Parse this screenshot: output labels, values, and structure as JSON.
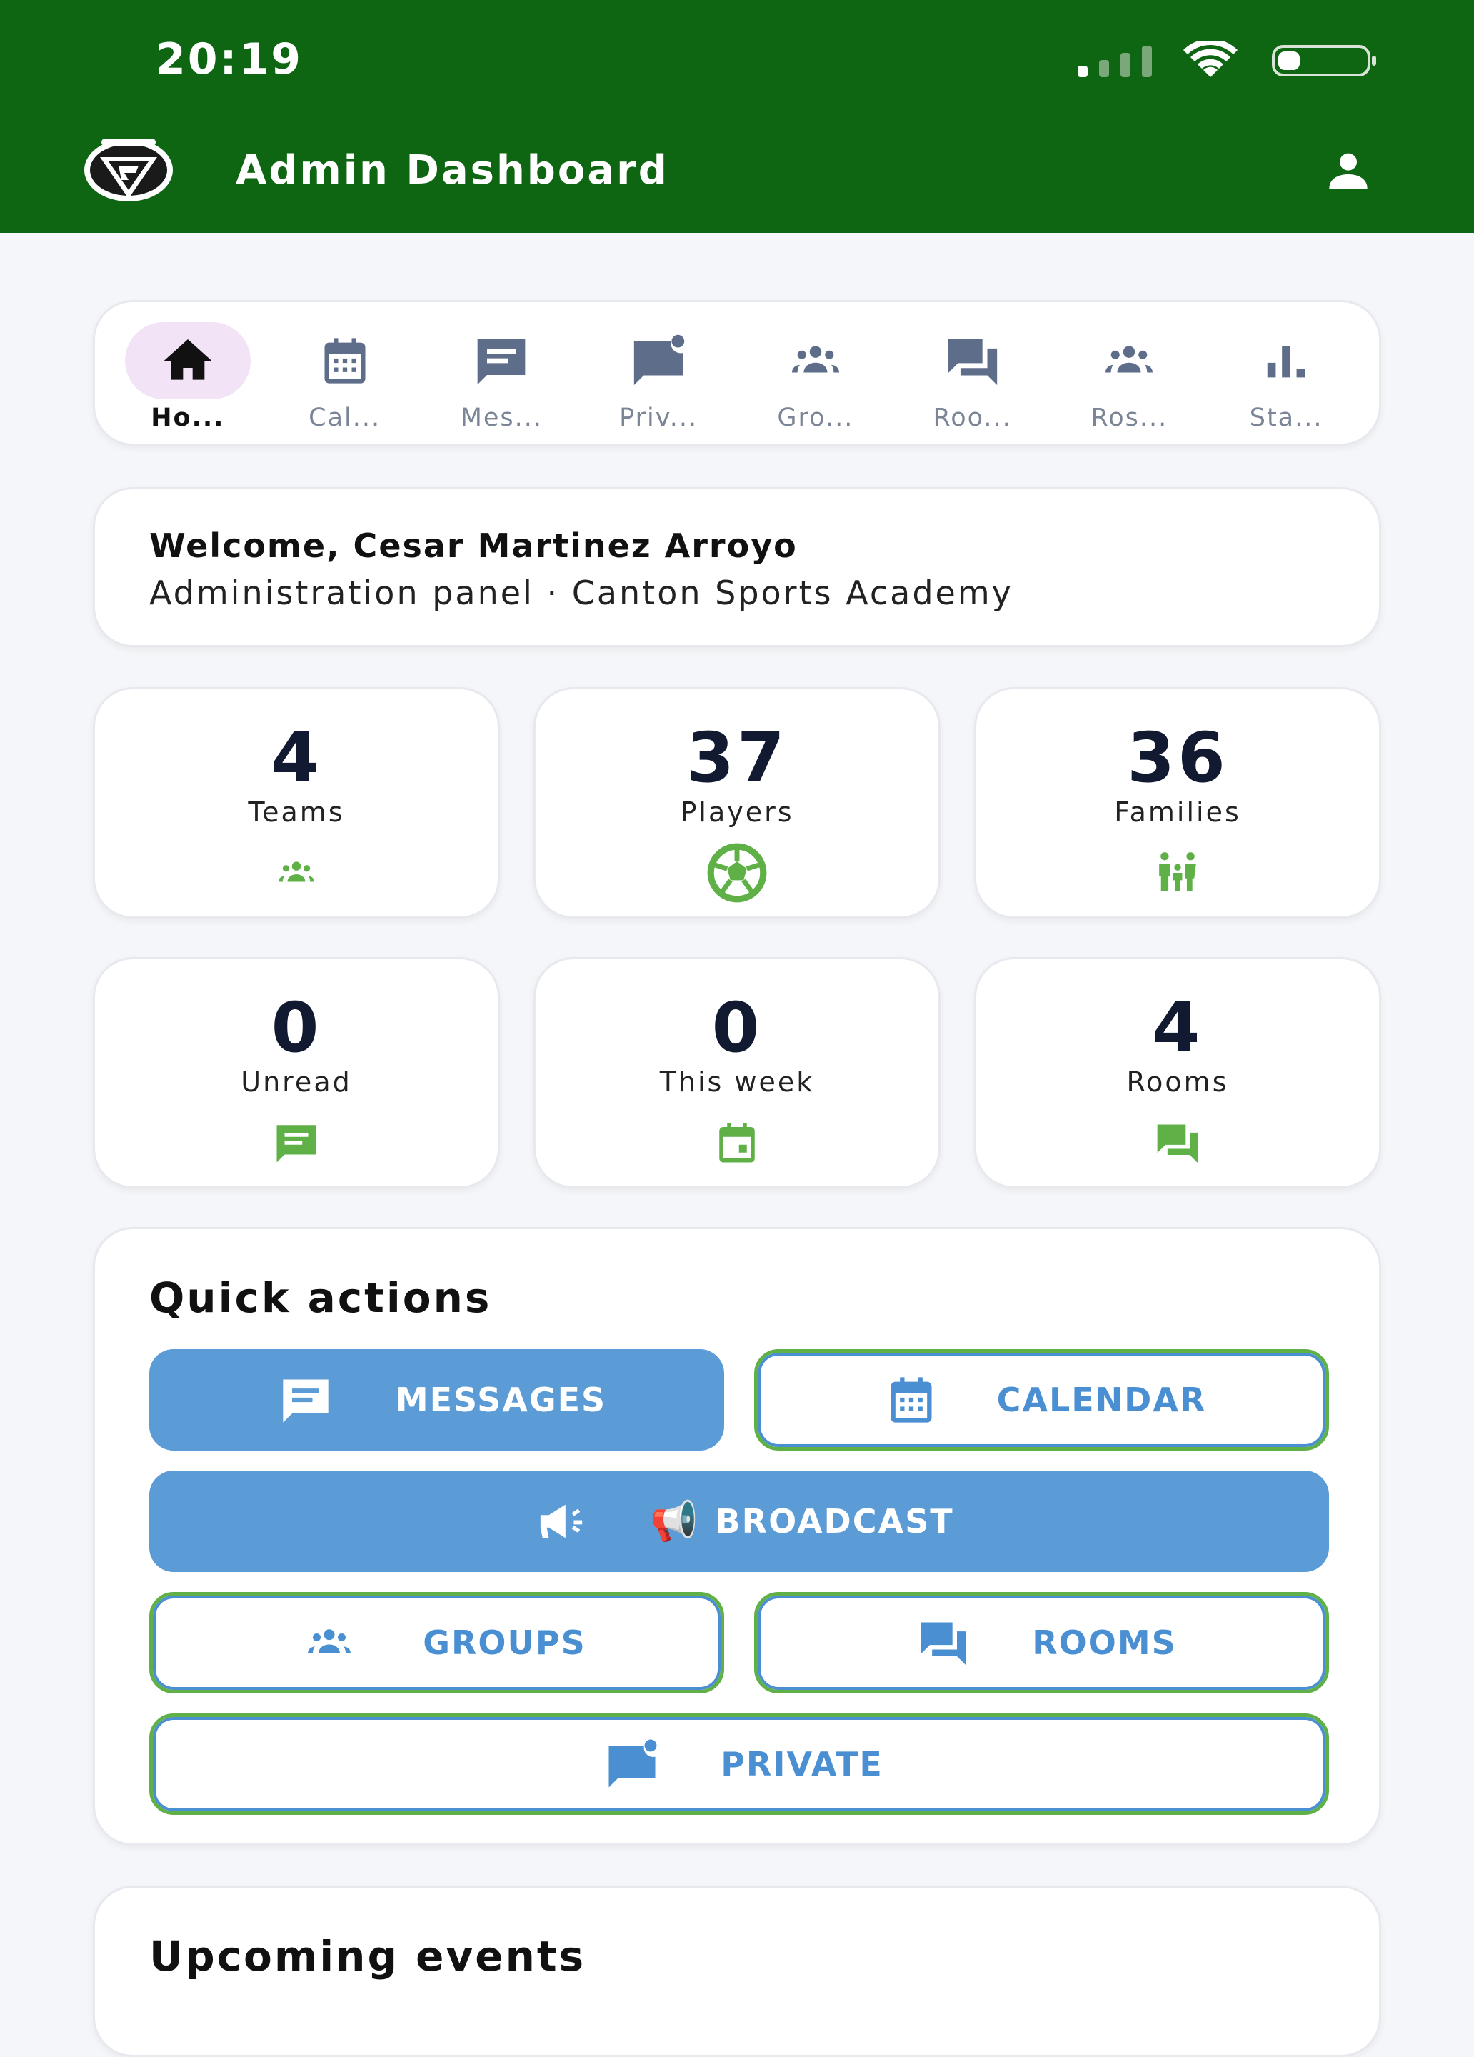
{
  "status_bar": {
    "time": "20:19"
  },
  "header": {
    "title": "Admin Dashboard"
  },
  "tabs": [
    {
      "label": "Ho...",
      "icon": "home-icon",
      "active": true
    },
    {
      "label": "Cal...",
      "icon": "calendar-icon"
    },
    {
      "label": "Mes...",
      "icon": "message-icon"
    },
    {
      "label": "Priv...",
      "icon": "private-message-icon"
    },
    {
      "label": "Gro...",
      "icon": "groups-icon"
    },
    {
      "label": "Roo...",
      "icon": "rooms-icon"
    },
    {
      "label": "Ros...",
      "icon": "roster-icon"
    },
    {
      "label": "Sta...",
      "icon": "stats-icon"
    }
  ],
  "welcome": {
    "title": "Welcome, Cesar Martinez Arroyo",
    "subtitle": "Administration panel · Canton Sports Academy"
  },
  "stats": [
    {
      "value": "4",
      "label": "Teams",
      "icon": "groups-icon"
    },
    {
      "value": "37",
      "label": "Players",
      "icon": "soccer-ball-icon"
    },
    {
      "value": "36",
      "label": "Families",
      "icon": "family-icon"
    },
    {
      "value": "0",
      "label": "Unread",
      "icon": "message-icon"
    },
    {
      "value": "0",
      "label": "This week",
      "icon": "event-icon"
    },
    {
      "value": "4",
      "label": "Rooms",
      "icon": "rooms-icon"
    }
  ],
  "quick_actions": {
    "title": "Quick actions",
    "messages": "MESSAGES",
    "calendar": "CALENDAR",
    "broadcast": "BROADCAST",
    "broadcast_emoji": "📢",
    "groups": "GROUPS",
    "rooms": "ROOMS",
    "private": "PRIVATE"
  },
  "upcoming": {
    "title": "Upcoming events"
  },
  "colors": {
    "header_bg": "#0e6612",
    "accent_blue": "#5b9bd6",
    "accent_green": "#5fb046",
    "tab_active_bg": "#f2e3f6"
  }
}
